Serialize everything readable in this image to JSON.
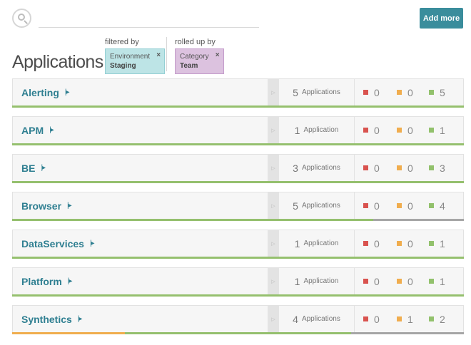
{
  "search": {
    "placeholder": ""
  },
  "toolbar": {
    "add_more_label": "Add more"
  },
  "page_title": "Applications",
  "filters": {
    "filtered_by_caption": "filtered by",
    "environment": {
      "key": "Environment",
      "value": "Staging",
      "remove": "×"
    },
    "rolled_up_by_caption": "rolled up by",
    "category": {
      "key": "Category",
      "value": "Team",
      "remove": "×"
    }
  },
  "colors": {
    "accent": "#3a8d9c",
    "critical": "#d9534f",
    "warning": "#f0ad4e",
    "healthy": "#92c16c",
    "unknown": "#a6a6a6"
  },
  "icons": {
    "search": "search-icon",
    "drill_down": "drill-down-icon",
    "expand": "expand-arrow-icon",
    "remove_filter": "close-icon"
  },
  "rows": [
    {
      "name": "Alerting",
      "count": "5",
      "count_label": "Applications",
      "critical": "0",
      "warning": "0",
      "healthy": "5",
      "health_bar": [
        {
          "status": "green",
          "fraction": 1.0
        }
      ]
    },
    {
      "name": "APM",
      "count": "1",
      "count_label": "Application",
      "critical": "0",
      "warning": "0",
      "healthy": "1",
      "health_bar": [
        {
          "status": "green",
          "fraction": 1.0
        }
      ]
    },
    {
      "name": "BE",
      "count": "3",
      "count_label": "Applications",
      "critical": "0",
      "warning": "0",
      "healthy": "3",
      "health_bar": [
        {
          "status": "green",
          "fraction": 1.0
        }
      ]
    },
    {
      "name": "Browser",
      "count": "5",
      "count_label": "Applications",
      "critical": "0",
      "warning": "0",
      "healthy": "4",
      "health_bar": [
        {
          "status": "green",
          "fraction": 0.8
        },
        {
          "status": "gray",
          "fraction": 0.2
        }
      ]
    },
    {
      "name": "DataServices",
      "count": "1",
      "count_label": "Application",
      "critical": "0",
      "warning": "0",
      "healthy": "1",
      "health_bar": [
        {
          "status": "green",
          "fraction": 1.0
        }
      ]
    },
    {
      "name": "Platform",
      "count": "1",
      "count_label": "Application",
      "critical": "0",
      "warning": "0",
      "healthy": "1",
      "health_bar": [
        {
          "status": "green",
          "fraction": 1.0
        }
      ]
    },
    {
      "name": "Synthetics",
      "count": "4",
      "count_label": "Applications",
      "critical": "0",
      "warning": "1",
      "healthy": "2",
      "health_bar": [
        {
          "status": "amber",
          "fraction": 0.25
        },
        {
          "status": "green",
          "fraction": 0.5
        },
        {
          "status": "gray",
          "fraction": 0.25
        }
      ]
    }
  ]
}
